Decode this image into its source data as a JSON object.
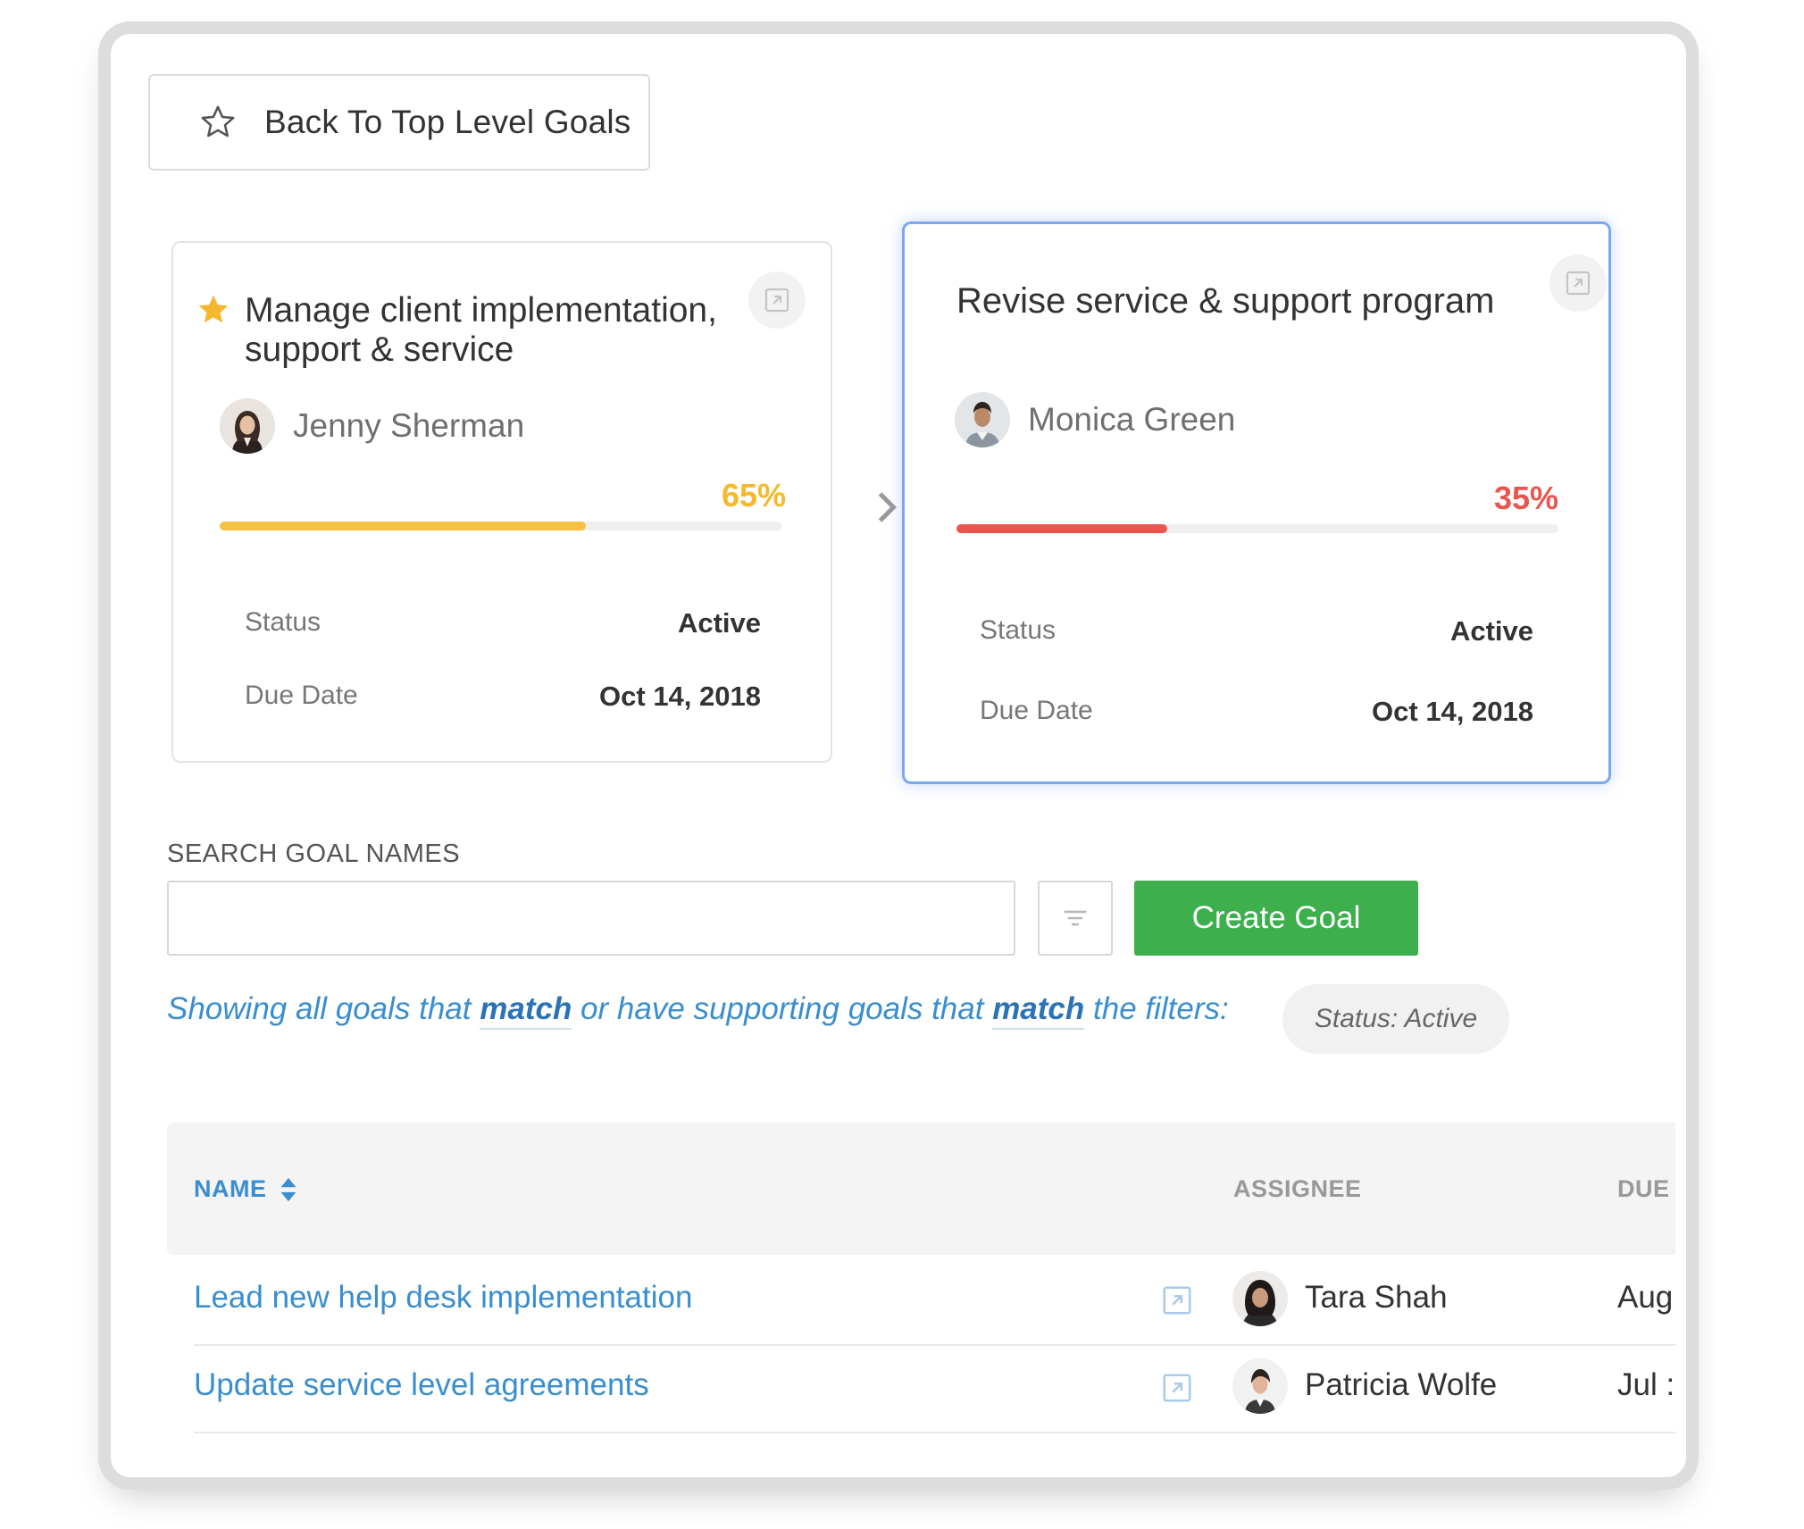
{
  "back_button": {
    "label": "Back To Top Level Goals",
    "icon": "star-outline-icon"
  },
  "cards": [
    {
      "title_line1": "Manage client implementation,",
      "title_line2": "support & service",
      "starred": true,
      "assignee": "Jenny Sherman",
      "progress_label": "65%",
      "progress": 0.65,
      "progress_color": "#f5c242",
      "status_label": "Status",
      "status_value": "Active",
      "due_label": "Due Date",
      "due_value": "Oct 14, 2018"
    },
    {
      "title_line1": "Revise service & support program",
      "assignee": "Monica Green",
      "progress_label": "35%",
      "progress": 0.35,
      "progress_color": "#e8564e",
      "status_label": "Status",
      "status_value": "Active",
      "due_label": "Due Date",
      "due_value": "Oct 14, 2018"
    }
  ],
  "search": {
    "label": "SEARCH GOAL NAMES",
    "value": "",
    "placeholder": "",
    "create_label": "Create Goal"
  },
  "filter_sentence": {
    "part1": "Showing all goals that ",
    "match1": "match",
    "part2": " or have supporting goals that ",
    "match2": "match",
    "part3": " the filters:",
    "chip": "Status: Active"
  },
  "table": {
    "headers": {
      "name": "NAME",
      "assignee": "ASSIGNEE",
      "due": "DUE"
    },
    "rows": [
      {
        "name": "Lead new help desk implementation",
        "assignee": "Tara Shah",
        "due": "Aug"
      },
      {
        "name": "Update service level agreements",
        "assignee": "Patricia Wolfe",
        "due": "Jul :"
      }
    ]
  },
  "colors": {
    "accent_blue": "#3a8ed0",
    "green": "#3daf4d",
    "active_border": "#7aa7ef"
  }
}
